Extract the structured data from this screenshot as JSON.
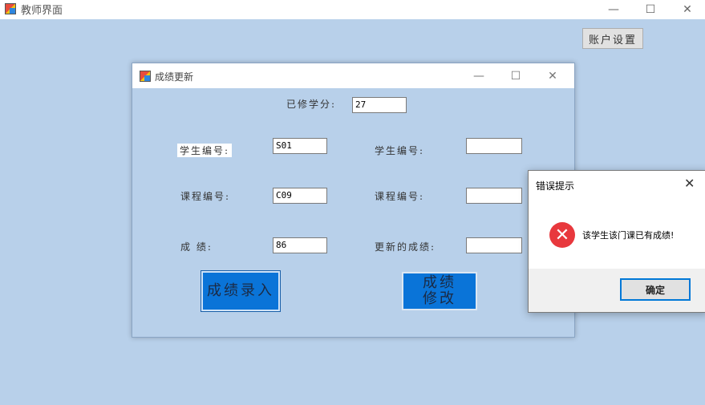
{
  "main_window": {
    "title": "教师界面",
    "controls": {
      "minimize": "—",
      "maximize": "☐",
      "close": "✕"
    },
    "account_button": "账户设置"
  },
  "grade_window": {
    "title": "成绩更新",
    "controls": {
      "minimize": "—",
      "maximize": "☐",
      "close": "✕"
    },
    "credits_label": "已修学分:",
    "credits_value": "27",
    "left": {
      "student_id_label": "学生编号:",
      "student_id_value": "S01",
      "course_id_label": "课程编号:",
      "course_id_value": "C09",
      "grade_label": "成   绩:",
      "grade_value": "86"
    },
    "right": {
      "student_id_label": "学生编号:",
      "student_id_value": "",
      "course_id_label": "课程编号:",
      "course_id_value": "",
      "new_grade_label": "更新的成绩:",
      "new_grade_value": ""
    },
    "enter_button": "成绩录入",
    "modify_button": "成绩修改"
  },
  "error_dialog": {
    "title": "错误提示",
    "close": "✕",
    "icon": "error-icon",
    "message": "该学生该门课已有成绩!",
    "ok_button": "确定"
  }
}
